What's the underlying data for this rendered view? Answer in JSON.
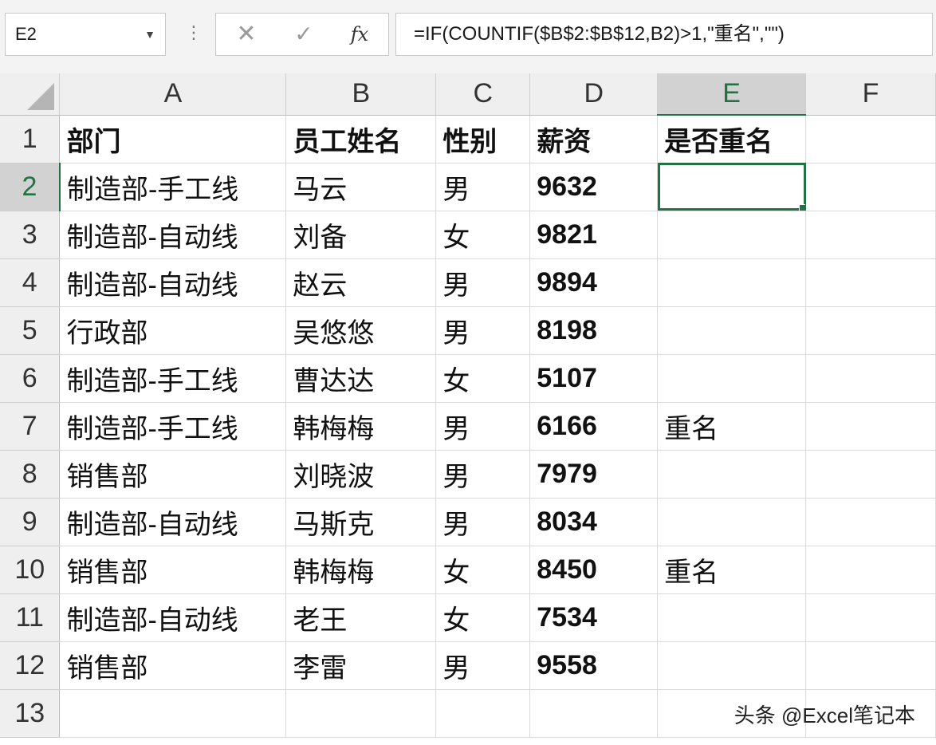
{
  "name_box": {
    "value": "E2",
    "dropdown_icon": "chevron-down-icon"
  },
  "formula_bar": {
    "cancel_icon": "✕",
    "enter_icon": "✓",
    "fx_label": "fx",
    "formula": "=IF(COUNTIF($B$2:$B$12,B2)>1,\"重名\",\"\")"
  },
  "columns": [
    "A",
    "B",
    "C",
    "D",
    "E",
    "F"
  ],
  "row_numbers": [
    "1",
    "2",
    "3",
    "4",
    "5",
    "6",
    "7",
    "8",
    "9",
    "10",
    "11",
    "12",
    "13"
  ],
  "header": [
    "部门",
    "员工姓名",
    "性别",
    "薪资",
    "是否重名",
    ""
  ],
  "rows": [
    [
      "制造部-手工线",
      "马云",
      "男",
      "9632",
      "",
      ""
    ],
    [
      "制造部-自动线",
      "刘备",
      "女",
      "9821",
      "",
      ""
    ],
    [
      "制造部-自动线",
      "赵云",
      "男",
      "9894",
      "",
      ""
    ],
    [
      "行政部",
      "吴悠悠",
      "男",
      "8198",
      "",
      ""
    ],
    [
      "制造部-手工线",
      "曹达达",
      "女",
      "5107",
      "",
      ""
    ],
    [
      "制造部-手工线",
      "韩梅梅",
      "男",
      "6166",
      "重名",
      ""
    ],
    [
      "销售部",
      "刘晓波",
      "男",
      "7979",
      "",
      ""
    ],
    [
      "制造部-自动线",
      "马斯克",
      "男",
      "8034",
      "",
      ""
    ],
    [
      "销售部",
      "韩梅梅",
      "女",
      "8450",
      "重名",
      ""
    ],
    [
      "制造部-自动线",
      "老王",
      "女",
      "7534",
      "",
      ""
    ],
    [
      "销售部",
      "李雷",
      "男",
      "9558",
      "",
      ""
    ],
    [
      "",
      "",
      "",
      "",
      "",
      ""
    ]
  ],
  "selection": {
    "cell": "E2",
    "accent": "#217346"
  },
  "watermark": "头条 @Excel笔记本"
}
